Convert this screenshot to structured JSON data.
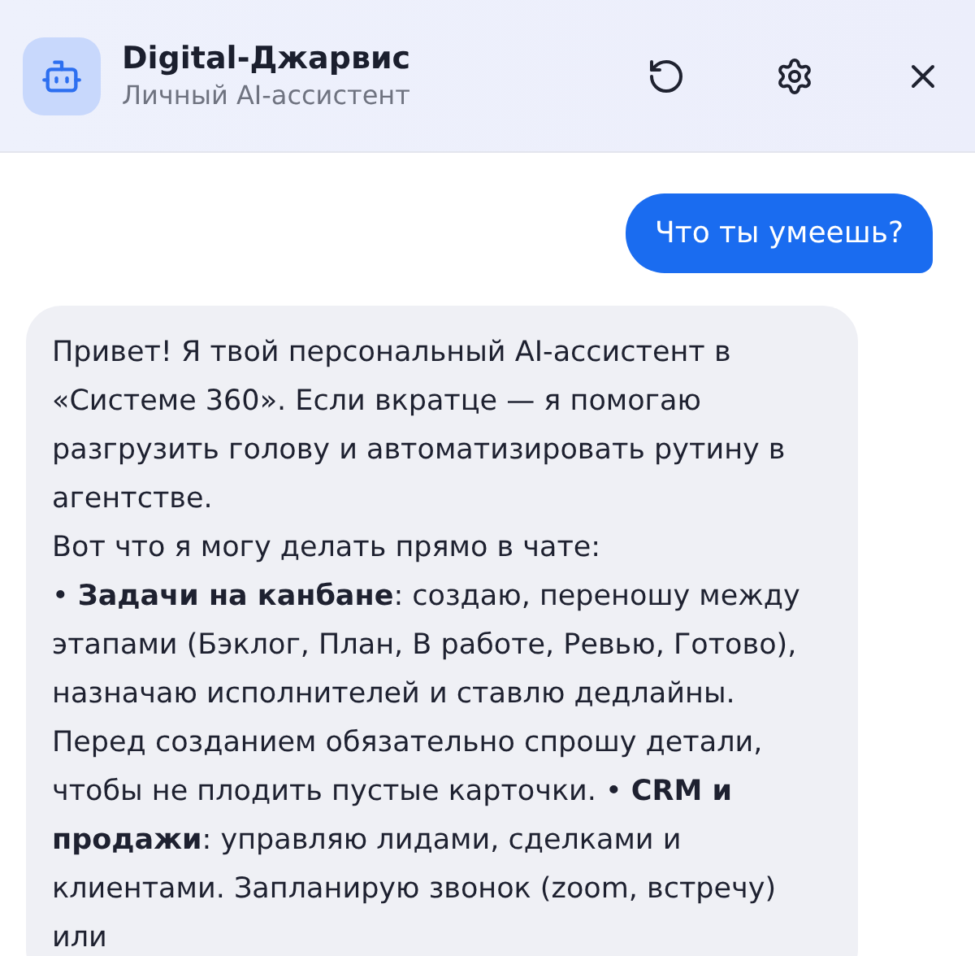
{
  "header": {
    "title": "Digital-Джарвис",
    "subtitle": "Личный AI-ассистент"
  },
  "messages": [
    {
      "kind": "user",
      "text": "Что ты умеешь?"
    },
    {
      "kind": "assistant",
      "text": "Привет! Я твой персональный AI-ассистент в «Системе 360». Если вкратце — я помогаю разгрузить голову и автоматизировать рутину в агентстве.\nВот что я могу делать прямо в чате:\n• **Задачи на канбане**: создаю, переношу между этапами (Бэклог, План, В работе, Ревью, Готово), назначаю исполнителей и ставлю дедлайны. Перед созданием обязательно спрошу детали, чтобы не плодить пустые карточки. • **CRM и продажи**: управляю лидами, сделками и клиентами. Запланирую звонок (zoom, встречу) или"
    }
  ]
}
